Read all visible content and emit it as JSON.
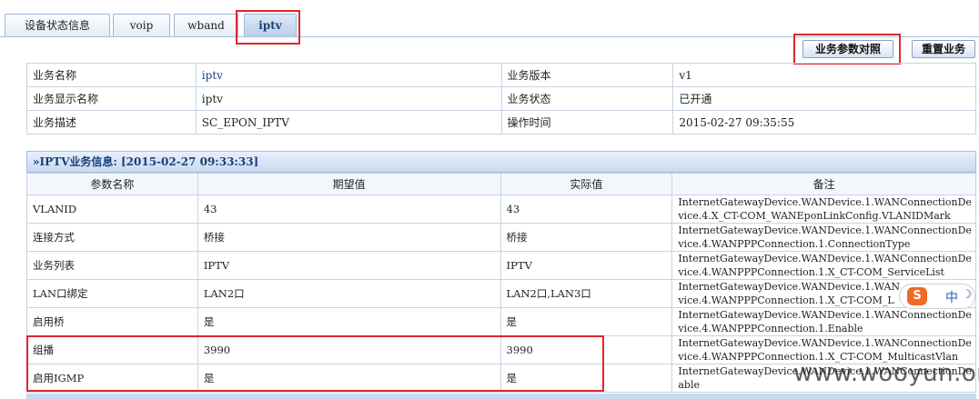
{
  "tabs": [
    {
      "label": "设备状态信息",
      "active": false
    },
    {
      "label": "voip",
      "active": false
    },
    {
      "label": "wband",
      "active": false
    },
    {
      "label": "iptv",
      "active": true
    }
  ],
  "actions": {
    "compare_label": "业务参数对照",
    "reset_label": "重置业务"
  },
  "service_info": {
    "name_label": "业务名称",
    "name_value": "iptv",
    "version_label": "业务版本",
    "version_value": "v1",
    "display_name_label": "业务显示名称",
    "display_name_value": "iptv",
    "status_label": "业务状态",
    "status_value": "已开通",
    "desc_label": "业务描述",
    "desc_value": "SC_EPON_IPTV",
    "op_time_label": "操作时间",
    "op_time_value": "2015-02-27 09:35:55"
  },
  "iptv_section": {
    "title": "»IPTV业务信息: [2015-02-27 09:33:33]",
    "columns": [
      "参数名称",
      "期望值",
      "实际值",
      "备注"
    ],
    "rows": [
      {
        "name": "VLANID",
        "expected": "43",
        "actual": "43",
        "remark1": "InternetGatewayDevice.WANDevice.1.WANConnectionDe",
        "remark2": "vice.4.X_CT-COM_WANEponLinkConfig.VLANIDMark"
      },
      {
        "name": "连接方式",
        "expected": "桥接",
        "actual": "桥接",
        "remark1": "InternetGatewayDevice.WANDevice.1.WANConnectionDe",
        "remark2": "vice.4.WANPPPConnection.1.ConnectionType"
      },
      {
        "name": "业务列表",
        "expected": "IPTV",
        "actual": "IPTV",
        "remark1": "InternetGatewayDevice.WANDevice.1.WANConnectionDe",
        "remark2": "vice.4.WANPPPConnection.1.X_CT-COM_ServiceList"
      },
      {
        "name": "LAN口绑定",
        "expected": "LAN2口",
        "actual": "LAN2口,LAN3口",
        "remark1": "InternetGatewayDevice.WANDevice.1.WAN",
        "remark2": "vice.4.WANPPPConnection.1.X_CT-COM_L"
      },
      {
        "name": "启用桥",
        "expected": "是",
        "actual": "是",
        "remark1": "InternetGatewayDevice.WANDevice.1.WANConnectionDe",
        "remark2": "vice.4.WANPPPConnection.1.Enable"
      },
      {
        "name": "组播",
        "expected": "3990",
        "actual": "3990",
        "remark1": "InternetGatewayDevice.WANDevice.1.WANConnectionDe",
        "remark2": "vice.4.WANPPPConnection.1.X_CT-COM_MulticastVlan"
      },
      {
        "name": "启用IGMP",
        "expected": "是",
        "actual": "是",
        "remark1": "InternetGatewayDevice.WANDevice.1.WANConnectionDe",
        "remark2": "able"
      }
    ]
  },
  "ime": {
    "logo": "S",
    "lang": "中",
    "moon": "☽"
  },
  "watermark": "www.wooyun.org",
  "colors": {
    "highlight": "#e0262b",
    "header_text": "#193e7a",
    "link": "#1d3f8f"
  }
}
